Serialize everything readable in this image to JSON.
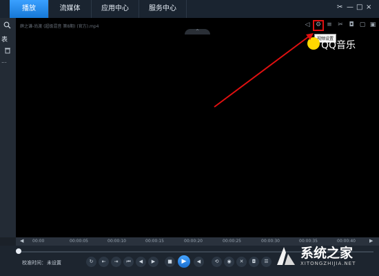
{
  "tabs": [
    "播放",
    "流媒体",
    "应用中心",
    "服务中心"
  ],
  "window_controls": [
    "✂",
    "—",
    "□",
    "×"
  ],
  "sidebar": {
    "search_icon": "search-icon",
    "label": "表"
  },
  "video": {
    "filename": "薛之谦-尚渡 (超级混音 第8期) (官方).mp4",
    "collapse_icon": "^",
    "tooltip": "视频设置",
    "brand": "QQ音乐"
  },
  "timeline": {
    "ticks": [
      "00:00",
      "00:00:05",
      "00:00:10",
      "00:00:15",
      "00:00:20",
      "00:00:25",
      "00:00:30",
      "00:00:35",
      "00:00:40"
    ]
  },
  "controls": {
    "calibration_label": "校准时间：",
    "calibration_value": "未设置",
    "play_icon": "▶"
  },
  "watermark": {
    "title": "系统之家",
    "url": "XITONGZHIJIA.NET"
  },
  "colors": {
    "accent": "#1a7ee0",
    "highlight": "#e01010",
    "arrow": "#e01010"
  }
}
